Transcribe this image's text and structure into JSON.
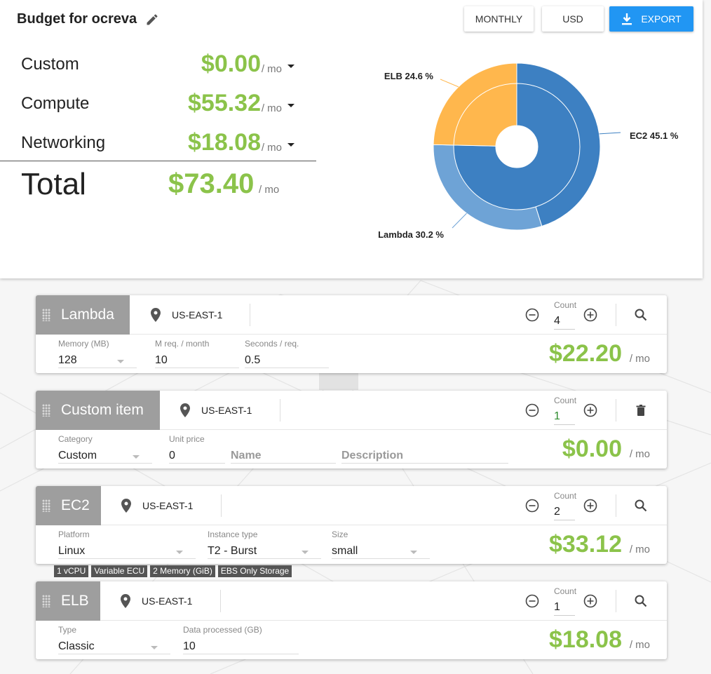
{
  "summary": {
    "title": "Budget for ocreva",
    "buttons": {
      "monthly": "MONTHLY",
      "currency": "USD",
      "export": "EXPORT"
    },
    "categories": [
      {
        "name": "Custom",
        "value": "$0.00",
        "unit": "/ mo"
      },
      {
        "name": "Compute",
        "value": "$55.32",
        "unit": "/ mo"
      },
      {
        "name": "Networking",
        "value": "$18.08",
        "unit": "/ mo"
      }
    ],
    "total": {
      "name": "Total",
      "value": "$73.40",
      "unit": "/ mo"
    }
  },
  "chart_data": {
    "type": "pie",
    "title": "",
    "slices": [
      {
        "label": "EC2 45.1 %",
        "value": 45.1,
        "color": "#3d80c2"
      },
      {
        "label": "Lambda 30.2 %",
        "value": 30.2,
        "color": "#6ea3d6"
      },
      {
        "label": "ELB 24.6 %",
        "value": 24.6,
        "color": "#ffb74d"
      }
    ],
    "inner_ring": [
      {
        "group": "Compute",
        "value": 75.3,
        "color": "#3d80c2"
      },
      {
        "group": "Networking",
        "value": 24.6,
        "color": "#ffb74d"
      }
    ]
  },
  "cards": [
    {
      "name": "Lambda",
      "region": "US-EAST-1",
      "count_label": "Count",
      "count": "4",
      "action_icon": "search-icon",
      "fields": [
        {
          "label": "Memory (MB)",
          "value": "128",
          "dropdown": true
        },
        {
          "label": "M req. / month",
          "value": "10"
        },
        {
          "label": "Seconds / req.",
          "value": "0.5"
        }
      ],
      "price": "$22.20",
      "unit": "/ mo"
    },
    {
      "name": "Custom item",
      "region": "US-EAST-1",
      "count_label": "Count",
      "count": "1",
      "action_icon": "trash-icon",
      "fields": [
        {
          "label": "Category",
          "value": "Custom",
          "dropdown": true
        },
        {
          "label": "Unit price",
          "value": "0"
        },
        {
          "label": "",
          "placeholder": "Name"
        },
        {
          "label": "",
          "placeholder": "Description"
        }
      ],
      "price": "$0.00",
      "unit": "/ mo"
    },
    {
      "name": "EC2",
      "region": "US-EAST-1",
      "count_label": "Count",
      "count": "2",
      "action_icon": "search-icon",
      "fields": [
        {
          "label": "Platform",
          "value": "Linux",
          "dropdown": true
        },
        {
          "label": "Instance type",
          "value": "T2 - Burst",
          "dropdown": true
        },
        {
          "label": "Size",
          "value": "small",
          "dropdown": true
        }
      ],
      "price": "$33.12",
      "unit": "/ mo",
      "tags": [
        "1 vCPU",
        "Variable ECU",
        "2 Memory (GiB)",
        "EBS Only Storage"
      ]
    },
    {
      "name": "ELB",
      "region": "US-EAST-1",
      "count_label": "Count",
      "count": "1",
      "action_icon": "search-icon",
      "fields": [
        {
          "label": "Type",
          "value": "Classic",
          "dropdown": true
        },
        {
          "label": "Data processed (GB)",
          "value": "10"
        }
      ],
      "price": "$18.08",
      "unit": "/ mo"
    }
  ]
}
